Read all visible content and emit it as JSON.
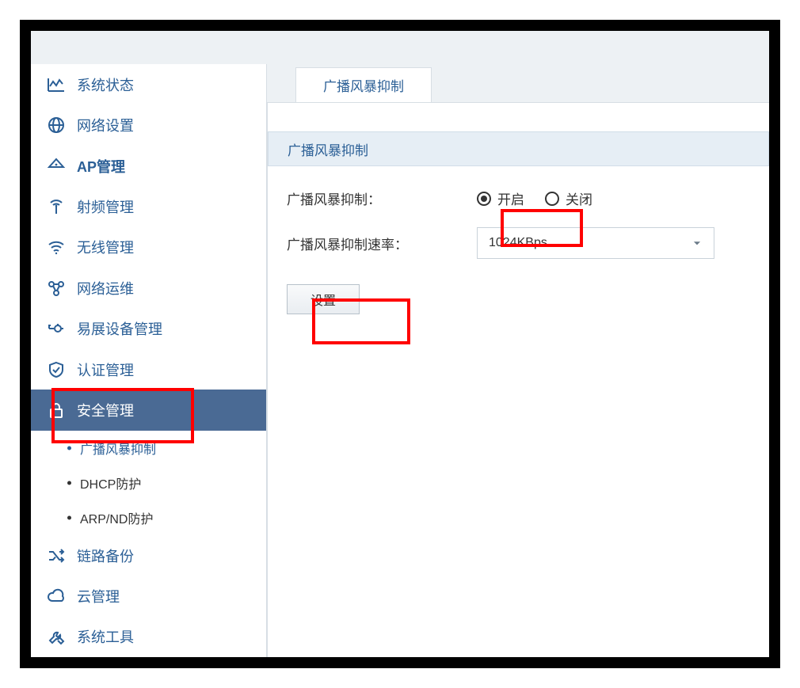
{
  "sidebar": {
    "items": [
      {
        "icon": "chart",
        "label": "系统状态"
      },
      {
        "icon": "globe",
        "label": "网络设置"
      },
      {
        "icon": "ap",
        "label": "AP管理",
        "bold": true
      },
      {
        "icon": "radio",
        "label": "射频管理"
      },
      {
        "icon": "wifi",
        "label": "无线管理"
      },
      {
        "icon": "ops",
        "label": "网络运维"
      },
      {
        "icon": "mesh",
        "label": "易展设备管理"
      },
      {
        "icon": "shield",
        "label": "认证管理"
      },
      {
        "icon": "lock",
        "label": "安全管理",
        "active": true
      },
      {
        "icon": "shuffle",
        "label": "链路备份"
      },
      {
        "icon": "cloud",
        "label": "云管理"
      },
      {
        "icon": "tools",
        "label": "系统工具"
      }
    ],
    "submenu": {
      "parent_index": 8,
      "items": [
        {
          "label": "广播风暴抑制",
          "selected": true
        },
        {
          "label": "DHCP防护"
        },
        {
          "label": "ARP/ND防护"
        }
      ]
    }
  },
  "main": {
    "tab_label": "广播风暴抑制",
    "section_title": "广播风暴抑制",
    "form": {
      "enable_label": "广播风暴抑制：",
      "enable_options": {
        "on": "开启",
        "off": "关闭"
      },
      "enable_value": "on",
      "rate_label": "广播风暴抑制速率：",
      "rate_value": "1024KBps"
    },
    "submit_label": "设置"
  }
}
